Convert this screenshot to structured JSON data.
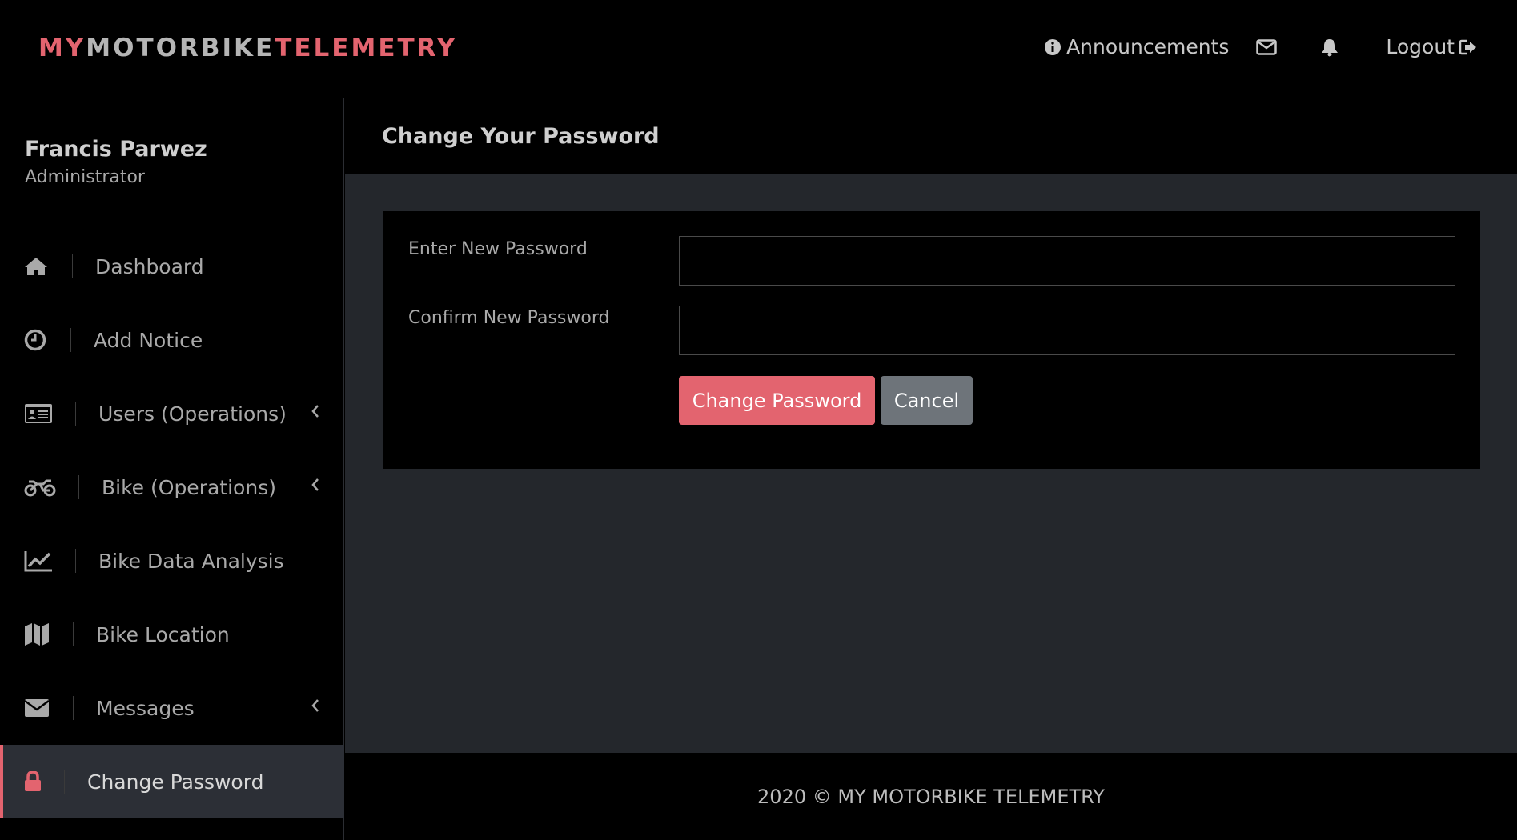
{
  "brand": {
    "part1": "MY",
    "part2": "MOTORBIKE",
    "part3": "TELEMETRY"
  },
  "topnav": {
    "announcements": "Announcements",
    "logout": "Logout",
    "icons": [
      "info-circle-icon",
      "envelope-icon",
      "bell-icon",
      "sign-out-icon"
    ]
  },
  "user": {
    "name": "Francis Parwez",
    "role": "Administrator"
  },
  "sidebar": {
    "items": [
      {
        "label": "Dashboard",
        "icon": "home-icon"
      },
      {
        "label": "Add Notice",
        "icon": "clock-icon"
      },
      {
        "label": "Users (Operations)",
        "icon": "id-card-icon",
        "has_submenu": true
      },
      {
        "label": "Bike (Operations)",
        "icon": "motorcycle-icon",
        "has_submenu": true
      },
      {
        "label": "Bike Data Analysis",
        "icon": "line-chart-icon"
      },
      {
        "label": "Bike Location",
        "icon": "map-icon"
      },
      {
        "label": "Messages",
        "icon": "envelope-icon",
        "has_submenu": true
      },
      {
        "label": "Change Password",
        "icon": "lock-icon",
        "active": true
      }
    ]
  },
  "page": {
    "title": "Change Your Password"
  },
  "form": {
    "new_password_label": "Enter New Password",
    "new_password_value": "",
    "confirm_password_label": "Confirm New Password",
    "confirm_password_value": "",
    "submit_label": "Change Password",
    "cancel_label": "Cancel"
  },
  "footer": {
    "text": "2020 © MY MOTORBIKE TELEMETRY"
  },
  "colors": {
    "accent": "#e3646f",
    "cancel": "#6e747a",
    "active_bg": "#2c2f36",
    "content_bg": "#24272c"
  }
}
